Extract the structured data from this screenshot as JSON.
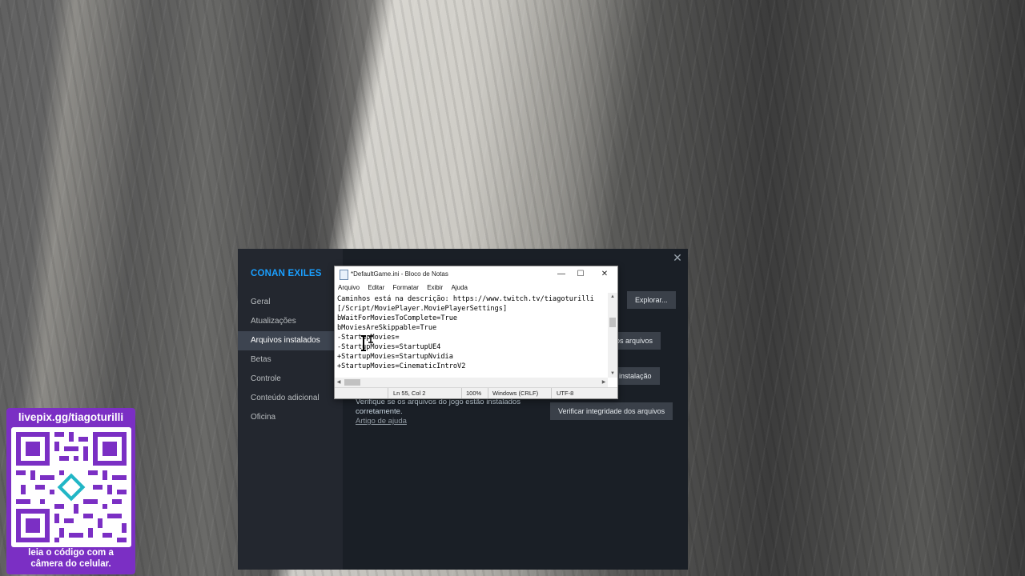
{
  "steam": {
    "game_title": "CONAN EXILES",
    "close_glyph": "✕",
    "nav": [
      {
        "label": "Geral"
      },
      {
        "label": "Atualizações"
      },
      {
        "label": "Arquivos instalados"
      },
      {
        "label": "Betas"
      },
      {
        "label": "Controle"
      },
      {
        "label": "Conteúdo adicional"
      },
      {
        "label": "Oficina"
      }
    ],
    "active_nav_index": 2,
    "buttons": {
      "explore": "Explorar...",
      "backup_partial": "ça dos arquivos",
      "move_partial": "a de instalação",
      "verify": "Verificar integridade dos arquivos"
    },
    "verify_description": "Verifique se os arquivos do jogo estão instalados corretamente.",
    "help_link": "Artigo de ajuda"
  },
  "notepad": {
    "title": "*DefaultGame.ini - Bloco de Notas",
    "controls": {
      "minimize": "—",
      "maximize": "☐",
      "close": "✕"
    },
    "menu": [
      "Arquivo",
      "Editar",
      "Formatar",
      "Exibir",
      "Ajuda"
    ],
    "lines": [
      "Caminhos está na descrição: https://www.twitch.tv/tiagoturilli",
      "[/Script/MoviePlayer.MoviePlayerSettings]",
      "bWaitForMoviesToComplete=True",
      "bMoviesAreSkippable=True",
      "-StartupMovies=",
      "-StartupMovies=StartupUE4",
      "+StartupMovies=StartupNvidia",
      "+StartupMovies=CinematicIntroV2"
    ],
    "status": {
      "position": "Ln 55, Col 2",
      "zoom": "100%",
      "line_endings": "Windows (CRLF)",
      "encoding": "UTF-8"
    }
  },
  "livepix": {
    "url": "livepix.gg/tiagoturilli",
    "caption_line1": "leia o código com a",
    "caption_line2": "câmera do celular."
  },
  "colors": {
    "steam_accent": "#1a9fff",
    "livepix_purple": "#7b2fc4",
    "qr_purple": "#7b2fc4",
    "qr_center": "#21b6c6"
  }
}
